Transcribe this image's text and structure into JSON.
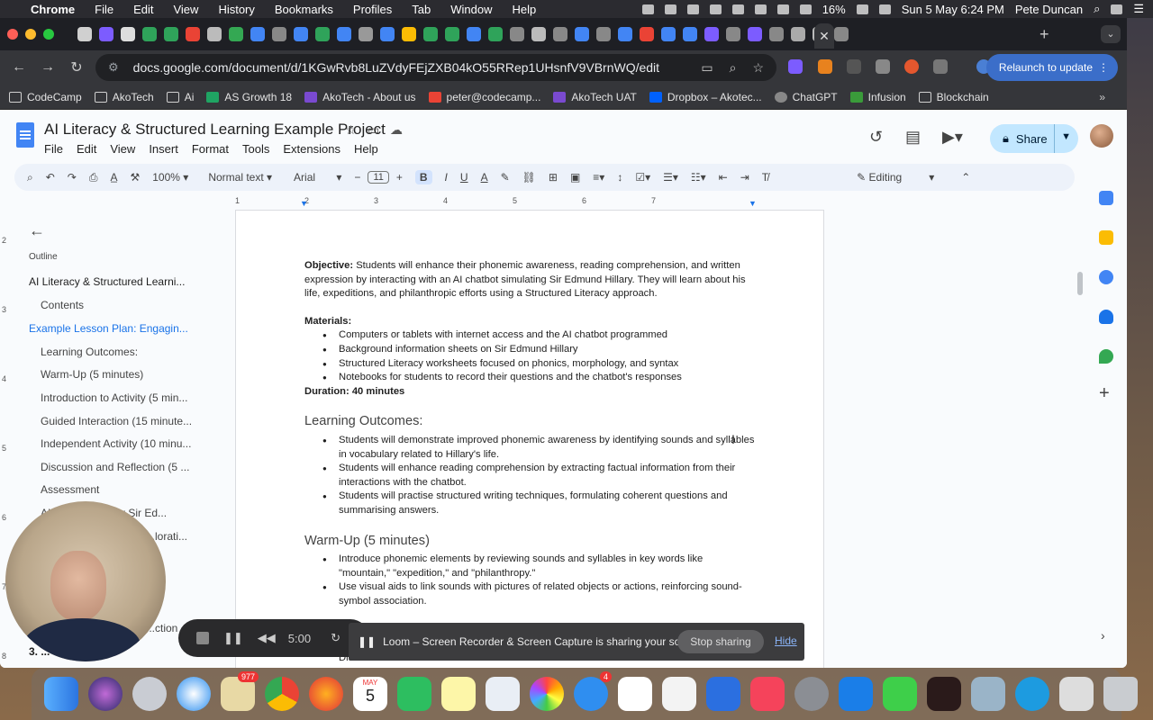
{
  "menubar": {
    "app": "Chrome",
    "items": [
      "File",
      "Edit",
      "View",
      "History",
      "Bookmarks",
      "Profiles",
      "Tab",
      "Window",
      "Help"
    ],
    "battery": "16%",
    "datetime": "Sun 5 May  6:24 PM",
    "user": "Pete Duncan"
  },
  "browser": {
    "url": "docs.google.com/document/d/1KGwRvb8LuZVdyFEjZXB04kO55RRep1UHsnfV9VBrnWQ/edit",
    "relaunch_label": "Relaunch to update",
    "bookmarks": [
      "CodeCamp",
      "AkoTech",
      "Ai",
      "AS Growth 18",
      "AkoTech - About us",
      "peter@codecamp...",
      "AkoTech UAT",
      "Dropbox – Akotec...",
      "ChatGPT",
      "Infusion",
      "Blockchain"
    ]
  },
  "docs": {
    "title": "AI Literacy & Structured Learning Example Project",
    "menus": [
      "File",
      "Edit",
      "View",
      "Insert",
      "Format",
      "Tools",
      "Extensions",
      "Help"
    ],
    "share_label": "Share",
    "zoom": "100%",
    "style": "Normal text",
    "font": "Arial",
    "font_size": "11",
    "mode": "Editing",
    "ruler": [
      "1",
      "2",
      "3",
      "4",
      "5",
      "6",
      "7"
    ],
    "vruler": [
      "2",
      "3",
      "4",
      "5",
      "6",
      "7",
      "8"
    ]
  },
  "outline": {
    "label": "Outline",
    "items": [
      "AI Literacy & Structured Learni...",
      "Contents",
      "Example Lesson Plan: Engagin...",
      "Learning Outcomes:",
      "Warm-Up (5 minutes)",
      "Introduction to Activity (5 min...",
      "Guided Interaction (15 minute...",
      "Independent Activity (10 minu...",
      "Discussion and Reflection (5 ...",
      "Assessment",
      "AI Chatbot ... t for Sir Ed...",
      "...lorati...",
      "...ction",
      "3. ... Chatbot ..."
    ]
  },
  "content": {
    "objective_label": "Objective:",
    "objective_text": " Students will enhance their phonemic awareness, reading comprehension, and written expression by interacting with an AI chatbot simulating Sir Edmund Hillary. They will learn about his life, expeditions, and philanthropic efforts using a Structured Literacy approach.",
    "materials_label": "Materials:",
    "materials": [
      "Computers or tablets with internet access and the AI chatbot programmed",
      "Background information sheets on Sir Edmund Hillary",
      "Structured Literacy worksheets focused on phonics, morphology, and syntax",
      "Notebooks for students to record their questions and the chatbot's responses"
    ],
    "duration": "Duration: 40 minutes",
    "outcomes_heading": "Learning Outcomes:",
    "outcomes": [
      "Students will demonstrate improved phonemic awareness by identifying sounds and syllables in vocabulary related to Hillary's life.",
      "Students will enhance reading comprehension by extracting factual information from their interactions with the chatbot.",
      "Students will practise structured writing techniques, formulating coherent questions and summarising answers."
    ],
    "warmup_heading": "Warm-Up (5 minutes)",
    "warmup": [
      "Introduce phonemic elements by reviewing sounds and syllables in key words like \"mountain,\" \"expedition,\" and \"philanthropy.\"",
      "Use visual aids to link sounds with pictures of related objects or actions, reinforcing sound-symbol association."
    ],
    "cutoff_line": "Discuss how chatbots function and their educational value."
  },
  "loom": {
    "timer": "5:00",
    "message": "Loom – Screen Recorder & Screen Capture is sharing your screen.",
    "stop_label": "Stop sharing",
    "hide_label": "Hide"
  },
  "dock": {
    "mail_badge": "977",
    "calendar_day": "5",
    "calendar_month": "MAY",
    "messages_badge": "4"
  }
}
